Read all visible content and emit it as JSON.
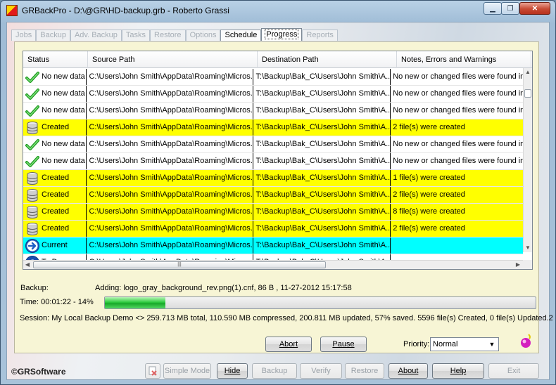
{
  "window": {
    "title": "GRBackPro - D:\\@GR\\HD-backup.grb - Roberto Grassi",
    "close_label": "✕",
    "max_label": "❐",
    "min_label": "▁"
  },
  "tabs": [
    {
      "label": "Jobs",
      "state": "disabled"
    },
    {
      "label": "Backup",
      "state": "disabled"
    },
    {
      "label": "Adv. Backup",
      "state": "disabled"
    },
    {
      "label": "Tasks",
      "state": "disabled"
    },
    {
      "label": "Restore",
      "state": "disabled"
    },
    {
      "label": "Options",
      "state": "disabled"
    },
    {
      "label": "Schedule",
      "state": "enabled"
    },
    {
      "label": "Progress",
      "state": "active"
    },
    {
      "label": "Reports",
      "state": "disabled"
    }
  ],
  "grid": {
    "columns": [
      "Status",
      "Source Path",
      "Destination Path",
      "Notes, Errors and Warnings"
    ],
    "rows": [
      {
        "icon": "checkmark-icon",
        "status": "No new data",
        "source": "C:\\Users\\John Smith\\AppData\\Roaming\\Micros...",
        "dest": "T:\\Backup\\Bak_C\\Users\\John Smith\\A...",
        "note": "No new or changed files were found in t",
        "kind": "nodata"
      },
      {
        "icon": "checkmark-icon",
        "status": "No new data",
        "source": "C:\\Users\\John Smith\\AppData\\Roaming\\Micros...",
        "dest": "T:\\Backup\\Bak_C\\Users\\John Smith\\A...",
        "note": "No new or changed files were found in t",
        "kind": "nodata"
      },
      {
        "icon": "checkmark-icon",
        "status": "No new data",
        "source": "C:\\Users\\John Smith\\AppData\\Roaming\\Micros...",
        "dest": "T:\\Backup\\Bak_C\\Users\\John Smith\\A...",
        "note": "No new or changed files were found in t",
        "kind": "nodata"
      },
      {
        "icon": "database-icon",
        "status": "Created",
        "source": "C:\\Users\\John Smith\\AppData\\Roaming\\Micros...",
        "dest": "T:\\Backup\\Bak_C\\Users\\John Smith\\A...",
        "note": "2 file(s) were created",
        "kind": "created"
      },
      {
        "icon": "checkmark-icon",
        "status": "No new data",
        "source": "C:\\Users\\John Smith\\AppData\\Roaming\\Micros...",
        "dest": "T:\\Backup\\Bak_C\\Users\\John Smith\\A...",
        "note": "No new or changed files were found in t",
        "kind": "nodata"
      },
      {
        "icon": "checkmark-icon",
        "status": "No new data",
        "source": "C:\\Users\\John Smith\\AppData\\Roaming\\Micros...",
        "dest": "T:\\Backup\\Bak_C\\Users\\John Smith\\A...",
        "note": "No new or changed files were found in t",
        "kind": "nodata"
      },
      {
        "icon": "database-icon",
        "status": "Created",
        "source": "C:\\Users\\John Smith\\AppData\\Roaming\\Micros...",
        "dest": "T:\\Backup\\Bak_C\\Users\\John Smith\\A...",
        "note": "1 file(s) were created",
        "kind": "created"
      },
      {
        "icon": "database-icon",
        "status": "Created",
        "source": "C:\\Users\\John Smith\\AppData\\Roaming\\Micros...",
        "dest": "T:\\Backup\\Bak_C\\Users\\John Smith\\A...",
        "note": "2 file(s) were created",
        "kind": "created"
      },
      {
        "icon": "database-icon",
        "status": "Created",
        "source": "C:\\Users\\John Smith\\AppData\\Roaming\\Micros...",
        "dest": "T:\\Backup\\Bak_C\\Users\\John Smith\\A...",
        "note": "8 file(s) were created",
        "kind": "created"
      },
      {
        "icon": "database-icon",
        "status": "Created",
        "source": "C:\\Users\\John Smith\\AppData\\Roaming\\Micros...",
        "dest": "T:\\Backup\\Bak_C\\Users\\John Smith\\A...",
        "note": "2 file(s) were created",
        "kind": "created"
      },
      {
        "icon": "arrow-right-icon",
        "status": "Current",
        "source": "C:\\Users\\John Smith\\AppData\\Roaming\\Micros...",
        "dest": "T:\\Backup\\Bak_C\\Users\\John Smith\\A...",
        "note": "",
        "kind": "current"
      },
      {
        "icon": "question-icon",
        "status": "To Do",
        "source": "C:\\Users\\John Smith\\AppData\\Roaming\\Micros...",
        "dest": "T:\\Backup\\Bak_C\\Users\\John Smith\\A...",
        "note": "",
        "kind": "todo"
      }
    ],
    "hscroll_grip": "|||"
  },
  "status": {
    "backup_label": "Backup:",
    "backup_value": "Adding: logo_gray_background_rev.png(1).cnf,  86 B , 11-27-2012 15:17:58",
    "time_label": "Time:  00:01:22 - 14%",
    "progress_fraction": 0.14,
    "session_text": "Session:  My Local Backup Demo <> 259.713 MB total,  110.590 MB compressed,  200.811 MB updated, 57% saved.  5596 file(s) Created, 0 file(s) Updated.2"
  },
  "actions": {
    "abort": "Abort",
    "pause": "Pause",
    "priority_label": "Priority:",
    "priority_value": "Normal"
  },
  "footer": {
    "copyright": "©GRSoftware",
    "buttons": [
      {
        "label": "Simple Mode",
        "enabled": false
      },
      {
        "label": "Hide",
        "enabled": true
      },
      {
        "label": "Backup",
        "enabled": false
      },
      {
        "label": "Verify",
        "enabled": false
      },
      {
        "label": "Restore",
        "enabled": false
      },
      {
        "label": "About",
        "enabled": true
      },
      {
        "label": "Help",
        "enabled": true
      },
      {
        "label": "Exit",
        "enabled": false
      }
    ]
  },
  "colors": {
    "created_row": "#ffff00",
    "current_row": "#00ffff",
    "panel": "#f7f5d5"
  }
}
